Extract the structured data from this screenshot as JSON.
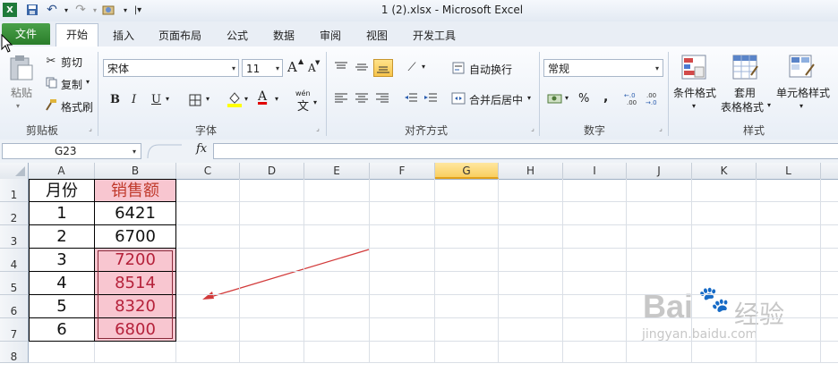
{
  "window": {
    "title": "1 (2).xlsx  -  Microsoft Excel"
  },
  "tabs": [
    "文件",
    "开始",
    "插入",
    "页面布局",
    "公式",
    "数据",
    "审阅",
    "视图",
    "开发工具"
  ],
  "clipboard": {
    "paste": "粘贴",
    "cut": "剪切",
    "copy": "复制",
    "format_painter": "格式刷",
    "label": "剪贴板"
  },
  "font": {
    "name": "宋体",
    "size": "11",
    "label": "字体",
    "bold": "B",
    "italic": "I",
    "underline": "U",
    "grow": "A",
    "shrink": "A",
    "font_color": "A",
    "phonetic": "wén"
  },
  "alignment": {
    "wrap": "自动换行",
    "merge": "合并后居中",
    "label": "对齐方式"
  },
  "number": {
    "format": "常规",
    "percent": "%",
    "comma": ",",
    "label": "数字"
  },
  "styles": {
    "conditional": "条件格式",
    "table1": "套用",
    "table2": "表格格式",
    "cell_styles": "单元格样式",
    "label": "样式"
  },
  "formula_bar": {
    "name_box": "G23",
    "fx": "fx",
    "value": ""
  },
  "columns": [
    "A",
    "B",
    "C",
    "D",
    "E",
    "F",
    "G",
    "H",
    "I",
    "J",
    "K",
    "L"
  ],
  "rows": [
    "1",
    "2",
    "3",
    "4",
    "5",
    "6",
    "7",
    "8"
  ],
  "cells": {
    "A": [
      "月份",
      "1",
      "2",
      "3",
      "4",
      "5",
      "6"
    ],
    "B": [
      "销售额",
      "6421",
      "6700",
      "7200",
      "8514",
      "8320",
      "6800"
    ]
  },
  "colors": {
    "highlight_fill": "#f8c6d0",
    "highlight_text": "#b5213a",
    "excel_green": "#2a7d2a",
    "arrow": "#d23a3a"
  },
  "watermark": {
    "brand": "Bai",
    "brand2": "经验",
    "url": "jingyan.baidu.com"
  }
}
